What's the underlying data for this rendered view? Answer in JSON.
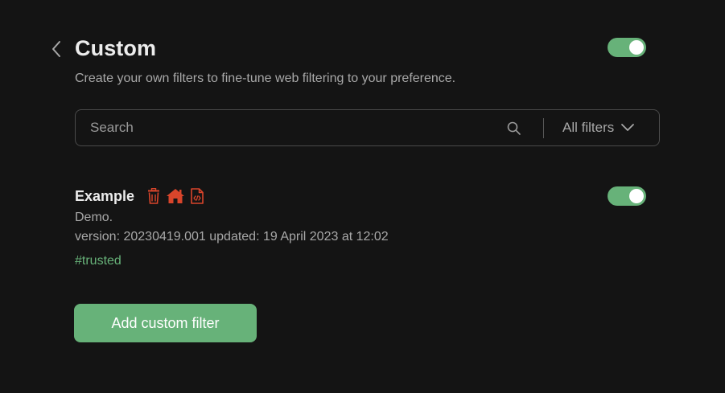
{
  "header": {
    "title": "Custom",
    "description": "Create your own filters to fine-tune web filtering to your preference.",
    "back_icon": "chevron-left-icon",
    "enabled": true
  },
  "search": {
    "placeholder": "Search",
    "value": "",
    "icon": "search-icon",
    "filter_dropdown": {
      "selected": "All filters",
      "icon": "chevron-down-icon"
    }
  },
  "filters": [
    {
      "name": "Example",
      "icons": [
        "trash-icon",
        "home-icon",
        "code-file-icon"
      ],
      "description": "Demo.",
      "version_line": "version: 20230419.001 updated: 19 April 2023 at 12:02",
      "tag": "#trusted",
      "enabled": true
    }
  ],
  "actions": {
    "add_label": "Add custom filter"
  },
  "colors": {
    "background": "#141414",
    "accent": "#67b279",
    "icon_red": "#d9452b",
    "text_primary": "#ececec",
    "text_secondary": "#a8a8a8",
    "border": "#4a4a4a"
  }
}
